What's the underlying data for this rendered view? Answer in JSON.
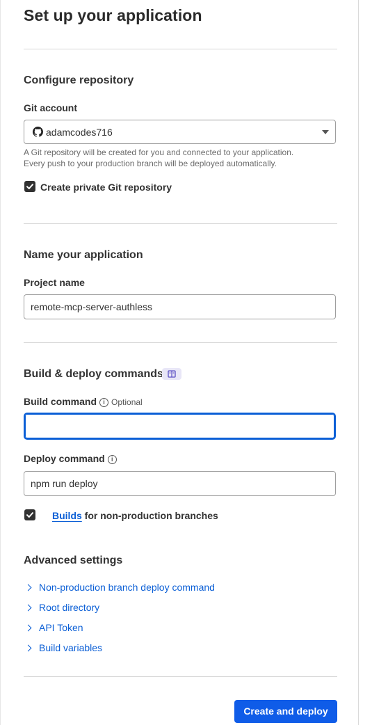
{
  "page": {
    "title": "Set up your application"
  },
  "repository": {
    "heading": "Configure repository",
    "git_account_label": "Git account",
    "git_account_value": "adamcodes716",
    "help_line1": "A Git repository will be created for you and connected to your application.",
    "help_line2": "Every push to your production branch will be deployed automatically.",
    "private_repo_label": "Create private Git repository",
    "private_repo_checked": true
  },
  "application": {
    "heading": "Name your application",
    "project_name_label": "Project name",
    "project_name_value": "remote-mcp-server-authless"
  },
  "build": {
    "heading": "Build & deploy commands",
    "build_command_label": "Build command",
    "build_command_optional": "Optional",
    "build_command_value": "",
    "deploy_command_label": "Deploy command",
    "deploy_command_value": "npm run deploy",
    "builds_link": "Builds",
    "builds_suffix": " for non-production branches",
    "builds_checked": true
  },
  "advanced": {
    "heading": "Advanced settings",
    "items": [
      {
        "label": "Non-production branch deploy command"
      },
      {
        "label": "Root directory"
      },
      {
        "label": "API Token"
      },
      {
        "label": "Build variables"
      }
    ]
  },
  "footer": {
    "submit_label": "Create and deploy"
  },
  "colors": {
    "accent": "#0f5ce8",
    "link": "#0b5fd6",
    "focus_ring": "#0b5fd6",
    "doc_badge": "#e8e6f7"
  },
  "icons": {
    "git_account": "github-icon",
    "select_caret": "caret-down-icon",
    "info": "info-icon",
    "docs_badge": "book-icon",
    "advanced_expand": "chevron-right-icon",
    "checkbox": "checkmark-icon"
  }
}
